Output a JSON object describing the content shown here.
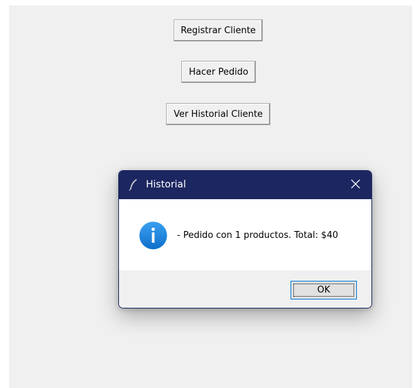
{
  "main_window": {
    "buttons": [
      {
        "label": "Registrar Cliente"
      },
      {
        "label": "Hacer Pedido"
      },
      {
        "label": "Ver Historial Cliente"
      }
    ]
  },
  "dialog": {
    "title": "Historial",
    "title_icon": "feather-icon",
    "close_icon": "close-icon",
    "message_icon": "info-icon",
    "message": "- Pedido con 1 productos. Total: $40",
    "ok_label": "OK"
  },
  "colors": {
    "titlebar": "#1c2660",
    "info_icon": "#1e88e5",
    "window_bg": "#f0f0f0",
    "content_bg": "#ffffff",
    "focus_border": "#0078d7"
  }
}
